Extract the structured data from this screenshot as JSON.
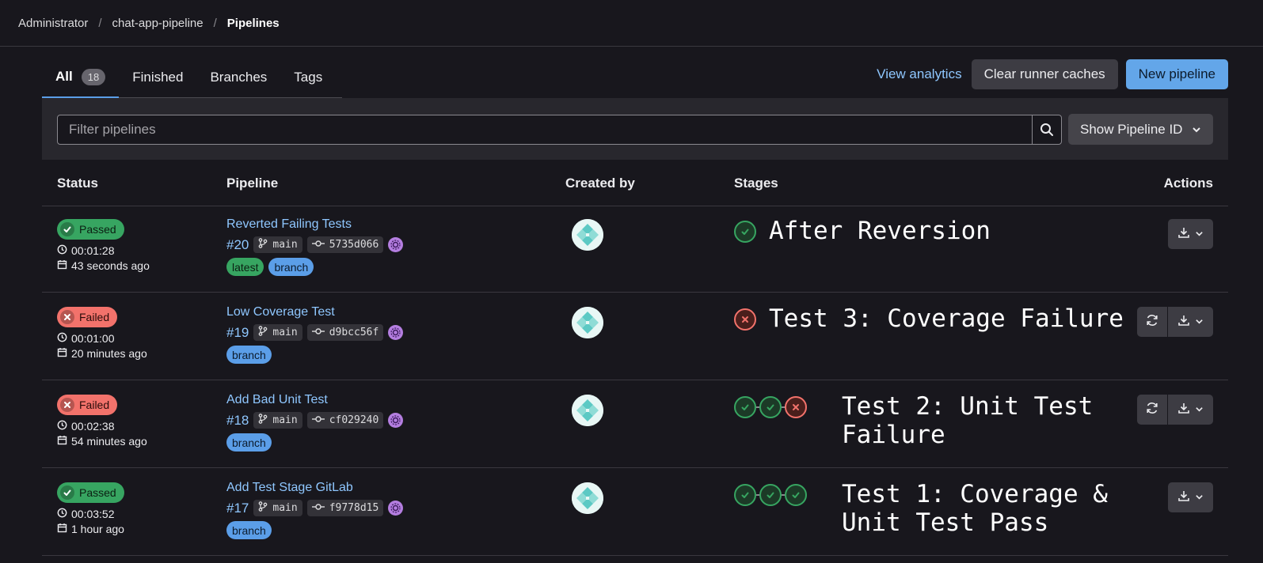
{
  "breadcrumb": {
    "root": "Administrator",
    "project": "chat-app-pipeline",
    "current": "Pipelines"
  },
  "tabs": [
    {
      "label": "All",
      "count": "18"
    },
    {
      "label": "Finished"
    },
    {
      "label": "Branches"
    },
    {
      "label": "Tags"
    }
  ],
  "header_actions": {
    "analytics": "View analytics",
    "clear_caches": "Clear runner caches",
    "new_pipeline": "New pipeline"
  },
  "filter": {
    "placeholder": "Filter pipelines",
    "show_id": "Show Pipeline ID"
  },
  "columns": {
    "status": "Status",
    "pipeline": "Pipeline",
    "created_by": "Created by",
    "stages": "Stages",
    "actions": "Actions"
  },
  "rows": [
    {
      "status": "Passed",
      "duration": "00:01:28",
      "finished": "43 seconds ago",
      "title": "Reverted Failing Tests",
      "id": "#20",
      "branch": "main",
      "commit": "5735d066",
      "tags": [
        "latest",
        "branch"
      ],
      "stages": [
        "passed"
      ],
      "annotation": "After Reversion",
      "retry": false
    },
    {
      "status": "Failed",
      "duration": "00:01:00",
      "finished": "20 minutes ago",
      "title": "Low Coverage Test",
      "id": "#19",
      "branch": "main",
      "commit": "d9bcc56f",
      "tags": [
        "branch"
      ],
      "stages": [
        "failed"
      ],
      "annotation": "Test 3: Coverage Failure",
      "retry": true
    },
    {
      "status": "Failed",
      "duration": "00:02:38",
      "finished": "54 minutes ago",
      "title": "Add Bad Unit Test",
      "id": "#18",
      "branch": "main",
      "commit": "cf029240",
      "tags": [
        "branch"
      ],
      "stages": [
        "passed",
        "passed",
        "failed"
      ],
      "annotation_lines": [
        "Test 2: Unit Test",
        "Failure"
      ],
      "retry": true
    },
    {
      "status": "Passed",
      "duration": "00:03:52",
      "finished": "1 hour ago",
      "title": "Add Test Stage GitLab",
      "id": "#17",
      "branch": "main",
      "commit": "f9778d15",
      "tags": [
        "branch"
      ],
      "stages": [
        "passed",
        "passed",
        "passed"
      ],
      "annotation_lines": [
        "Test 1: Coverage &",
        "Unit Test Pass"
      ],
      "retry": false
    }
  ],
  "colors": {
    "passed": "#37a561",
    "failed": "#f2726b",
    "link": "#8fc7ff",
    "primary": "#63a6e9"
  },
  "icons": {
    "search": "search-icon",
    "chevron": "chevron-down-icon",
    "clock": "clock-icon",
    "calendar": "calendar-icon",
    "branch": "branch-icon",
    "commit": "commit-icon",
    "download": "download-icon",
    "retry": "retry-icon"
  }
}
